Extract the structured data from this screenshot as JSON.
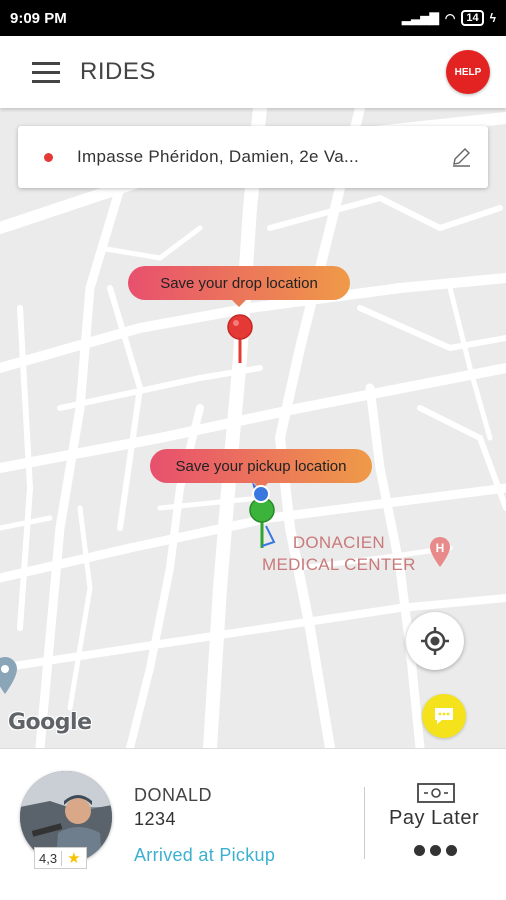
{
  "status_bar": {
    "time": "9:09 PM",
    "signal": "...ıl",
    "battery": "14"
  },
  "app_bar": {
    "title": "RIDES",
    "help_label": "HELP"
  },
  "address_bar": {
    "address": "Impasse Phéridon, Damien, 2e Va..."
  },
  "map": {
    "drop_tooltip": "Save your drop location",
    "pickup_tooltip": "Save your pickup location",
    "poi_line1": "DONACIEN",
    "poi_line2": "MEDICAL CENTER",
    "google": "Google"
  },
  "driver": {
    "name": "DONALD",
    "code": "1234",
    "status": "Arrived at Pickup",
    "rating": "4,3"
  },
  "payment": {
    "label": "Pay Later"
  },
  "colors": {
    "help_red": "#e32222",
    "status_blue": "#3bb0cf",
    "chat_yellow": "#f4e21c"
  }
}
